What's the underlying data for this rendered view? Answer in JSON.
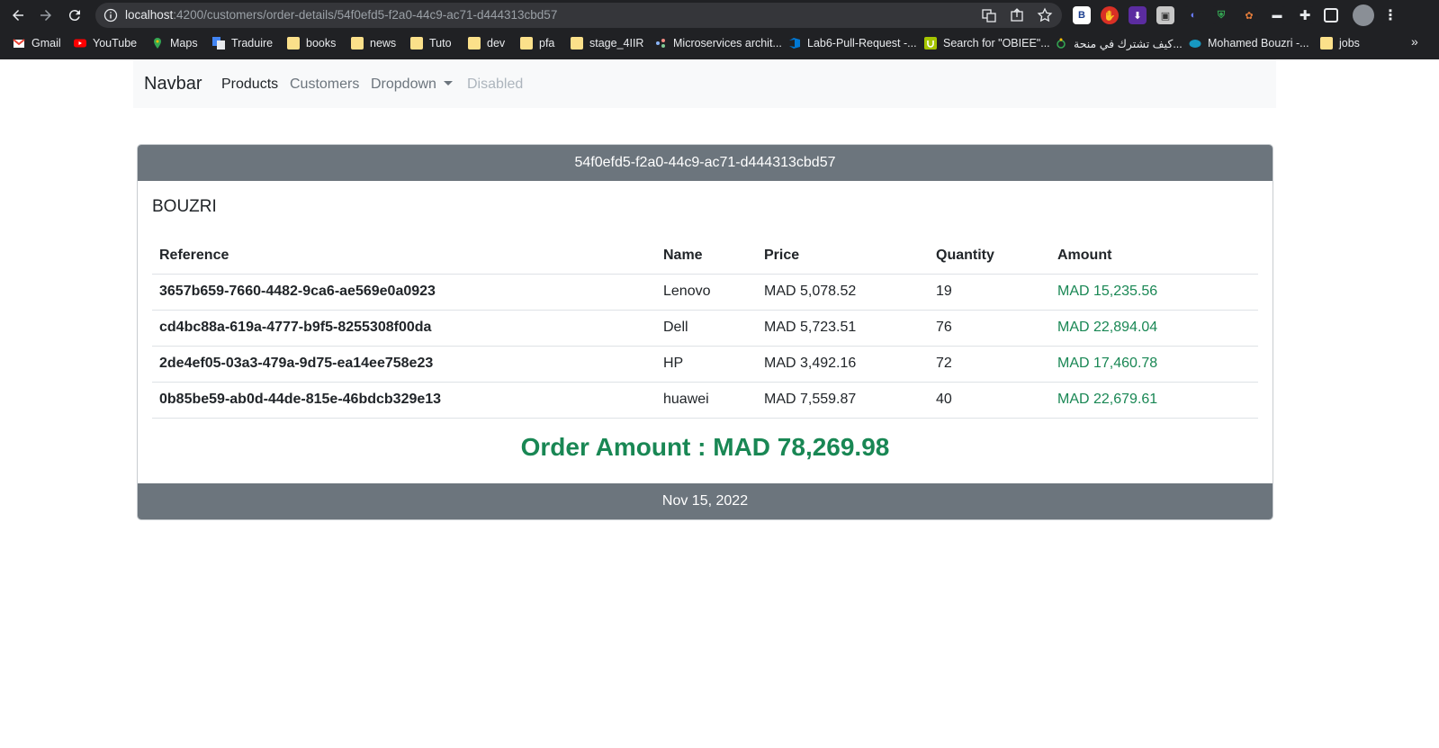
{
  "browser": {
    "url_host": "localhost",
    "url_path": ":4200/customers/order-details/54f0efd5-f2a0-44c9-ac71-d444313cbd57",
    "bookmarks": [
      {
        "label": "Gmail",
        "icon": "gmail-icon"
      },
      {
        "label": "YouTube",
        "icon": "youtube-icon"
      },
      {
        "label": "Maps",
        "icon": "maps-icon"
      },
      {
        "label": "Traduire",
        "icon": "translate-icon"
      },
      {
        "label": "books",
        "icon": "folder-icon"
      },
      {
        "label": "news",
        "icon": "folder-icon"
      },
      {
        "label": "Tuto",
        "icon": "folder-icon"
      },
      {
        "label": "dev",
        "icon": "folder-icon"
      },
      {
        "label": "pfa",
        "icon": "folder-icon"
      },
      {
        "label": "stage_4IIR",
        "icon": "folder-icon"
      },
      {
        "label": "Microservices archit...",
        "icon": "site-icon"
      },
      {
        "label": "Lab6-Pull-Request -...",
        "icon": "azure-devops-icon"
      },
      {
        "label": "Search for \"OBIEE\"...",
        "icon": "udemy-icon"
      },
      {
        "label": "كيف تشترك في منحة...",
        "icon": "site-icon"
      },
      {
        "label": "Mohamed Bouzri -...",
        "icon": "salesforce-icon"
      },
      {
        "label": "jobs",
        "icon": "folder-icon"
      }
    ],
    "more_label": "»"
  },
  "navbar": {
    "brand": "Navbar",
    "links": [
      {
        "label": "Products",
        "state": "active"
      },
      {
        "label": "Customers",
        "state": "normal"
      },
      {
        "label": "Dropdown",
        "state": "dropdown"
      },
      {
        "label": "Disabled",
        "state": "disabled"
      }
    ]
  },
  "order": {
    "id": "54f0efd5-f2a0-44c9-ac71-d444313cbd57",
    "customer_name": "BOUZRI",
    "columns": [
      "Reference",
      "Name",
      "Price",
      "Quantity",
      "Amount"
    ],
    "items": [
      {
        "reference": "3657b659-7660-4482-9ca6-ae569e0a0923",
        "name": "Lenovo",
        "price": "MAD 5,078.52",
        "quantity": "19",
        "amount": "MAD 15,235.56"
      },
      {
        "reference": "cd4bc88a-619a-4777-b9f5-8255308f00da",
        "name": "Dell",
        "price": "MAD 5,723.51",
        "quantity": "76",
        "amount": "MAD 22,894.04"
      },
      {
        "reference": "2de4ef05-03a3-479a-9d75-ea14ee758e23",
        "name": "HP",
        "price": "MAD 3,492.16",
        "quantity": "72",
        "amount": "MAD 17,460.78"
      },
      {
        "reference": "0b85be59-ab0d-44de-815e-46bdcb329e13",
        "name": "huawei",
        "price": "MAD 7,559.87",
        "quantity": "40",
        "amount": "MAD 22,679.61"
      }
    ],
    "total_label": "Order Amount : MAD 78,269.98",
    "date": "Nov 15, 2022"
  },
  "colors": {
    "chrome_bg": "#202124",
    "navbar_bg": "#f8f9fa",
    "card_header_bg": "#6c757d",
    "amount_green": "#198754"
  }
}
